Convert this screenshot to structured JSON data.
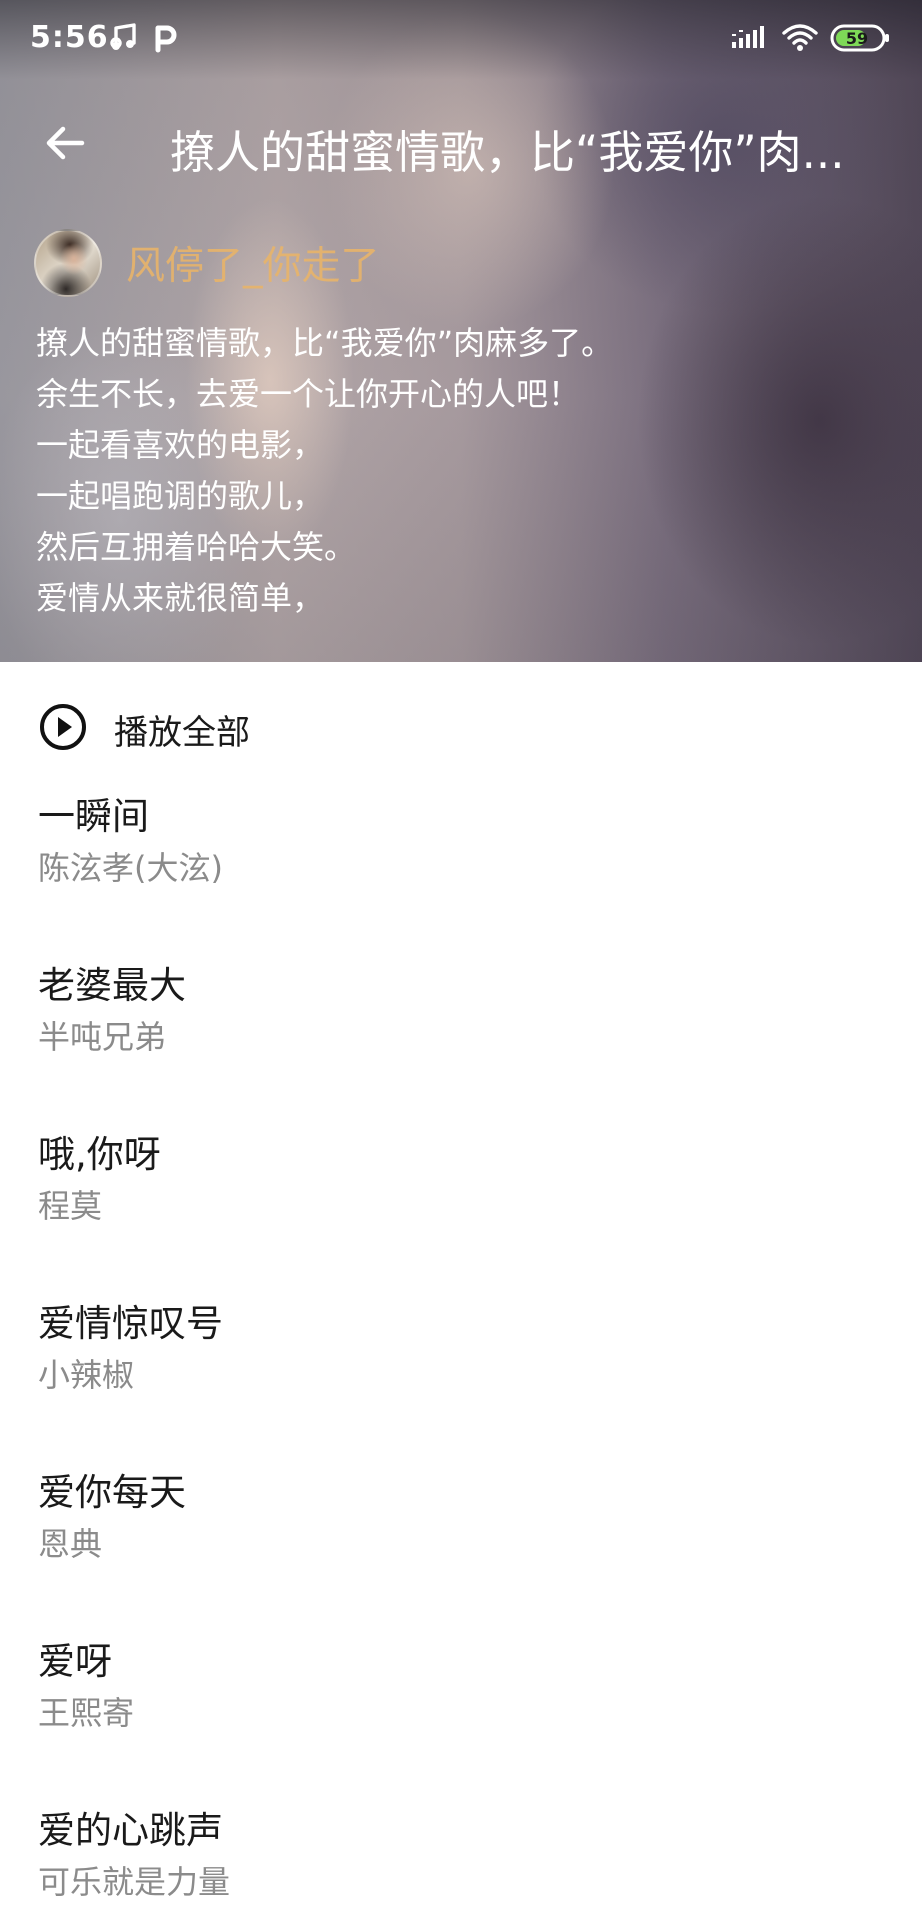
{
  "status_bar": {
    "time": "5:56",
    "battery": "59",
    "icons": [
      "music-note-icon",
      "p-app-icon",
      "signal-icon",
      "wifi-icon",
      "battery-icon"
    ]
  },
  "nav": {
    "back_icon": "arrow-left-icon",
    "title": "撩人的甜蜜情歌，比“我爱你”肉..."
  },
  "author": {
    "name": "风停了_你走了"
  },
  "description": {
    "lines": [
      "撩人的甜蜜情歌，比“我爱你”肉麻多了。",
      "余生不长，去爱一个让你开心的人吧！",
      "一起看喜欢的电影，",
      "一起唱跑调的歌儿，",
      "然后互拥着哈哈大笑。",
      "爱情从来就很简单，"
    ]
  },
  "play_all": {
    "label": "播放全部",
    "icon": "play-circle-icon"
  },
  "songs": [
    {
      "title": "一瞬间",
      "artist": "陈泫孝(大泫)"
    },
    {
      "title": "老婆最大",
      "artist": "半吨兄弟"
    },
    {
      "title": "哦,你呀",
      "artist": "程莫"
    },
    {
      "title": "爱情惊叹号",
      "artist": "小辣椒"
    },
    {
      "title": "爱你每天",
      "artist": "恩典"
    },
    {
      "title": "爱呀",
      "artist": "王熙寄"
    },
    {
      "title": "爱的心跳声",
      "artist": "可乐就是力量"
    }
  ],
  "colors": {
    "author_name": "#e8b46a",
    "song_title": "#1a1a1a",
    "song_artist": "#8b8b8b",
    "battery_fill": "#7ed957"
  }
}
